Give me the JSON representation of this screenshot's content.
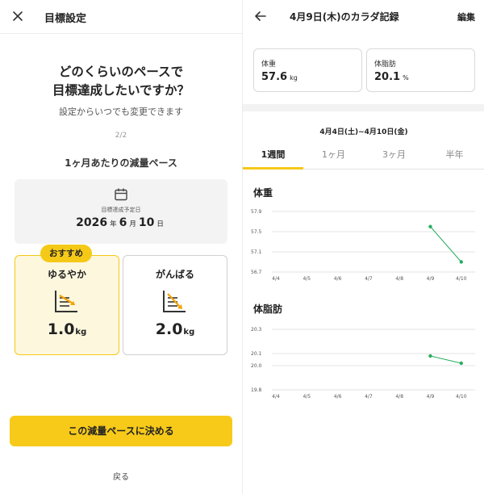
{
  "left": {
    "header": {
      "title": "目標設定",
      "close_icon": "close-icon"
    },
    "question_line1": "どのくらいのペースで",
    "question_line2": "目標達成したいですか？",
    "subtitle": "設定からいつでも変更できます",
    "step": "2/2",
    "pace_title": "1ヶ月あたりの減量ペース",
    "target_date": {
      "icon": "calendar-icon",
      "label": "目標達成予定日",
      "year": "2026",
      "year_unit": "年",
      "month": "6",
      "month_unit": "月",
      "day": "10",
      "day_unit": "日"
    },
    "recommend_badge": "おすすめ",
    "options": [
      {
        "name": "ゆるやか",
        "value": "1.0",
        "unit": "kg",
        "selected": true,
        "icon": "gentle-slope-graph-icon"
      },
      {
        "name": "がんばる",
        "value": "2.0",
        "unit": "kg",
        "selected": false,
        "icon": "steep-slope-graph-icon"
      }
    ],
    "cta": "この減量ペースに決める",
    "back": "戻る",
    "accent": "#f5c917"
  },
  "right": {
    "header": {
      "title": "4月9日(木)のカラダ記録",
      "edit": "編集",
      "back_icon": "arrow-left-icon"
    },
    "weight": {
      "label": "体重",
      "value": "57.6",
      "unit": "kg"
    },
    "body_fat": {
      "label": "体脂肪",
      "value": "20.1",
      "unit": "%"
    },
    "range": "4月4日(土)~4月10日(金)",
    "tabs": [
      "1週間",
      "1ヶ月",
      "3ヶ月",
      "半年"
    ],
    "active_tab": 0,
    "line_color": "#27ae60"
  },
  "chart_data": [
    {
      "type": "line",
      "title": "体重",
      "x": [
        "4/4",
        "4/5",
        "4/6",
        "4/7",
        "4/8",
        "4/9",
        "4/10"
      ],
      "y_ticks": [
        "57.9",
        "57.5",
        "57.1",
        "56.7"
      ],
      "ylim": [
        56.7,
        57.9
      ],
      "series": [
        {
          "values": [
            null,
            null,
            null,
            null,
            null,
            57.6,
            56.9
          ]
        }
      ]
    },
    {
      "type": "line",
      "title": "体脂肪",
      "x": [
        "4/4",
        "4/5",
        "4/6",
        "4/7",
        "4/8",
        "4/9",
        "4/10"
      ],
      "y_ticks": [
        "20.3",
        "20.1",
        "20.0",
        "19.8"
      ],
      "ylim": [
        19.8,
        20.3
      ],
      "series": [
        {
          "values": [
            null,
            null,
            null,
            null,
            null,
            20.08,
            20.02
          ]
        }
      ]
    }
  ]
}
